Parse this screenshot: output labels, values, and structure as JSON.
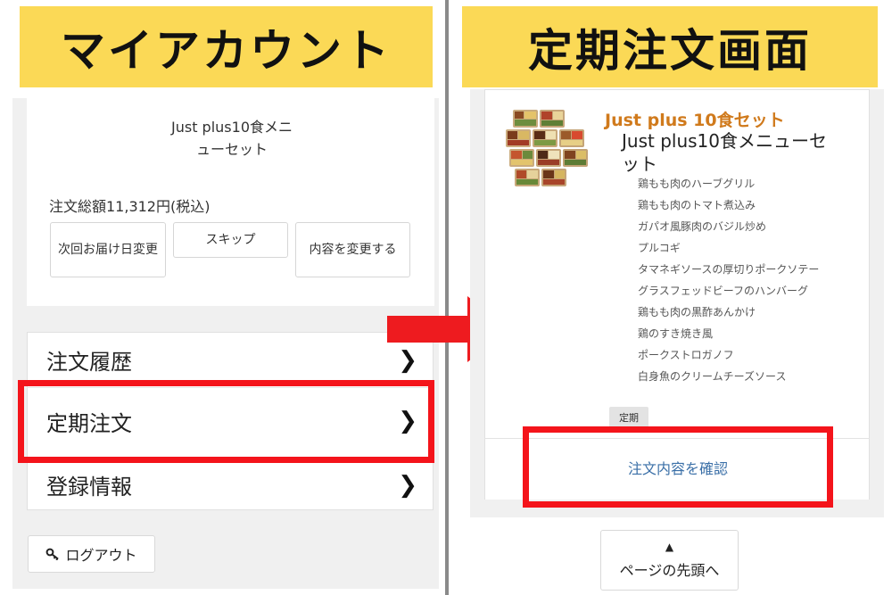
{
  "left": {
    "banner": "マイアカウント",
    "product_name": "Just plus10食メニューセット",
    "order_total": "注文総額11,312円(税込)",
    "buttons": {
      "next_delivery": "次回お届け日変更",
      "skip": "スキップ",
      "change_contents": "内容を変更する"
    },
    "menu": [
      {
        "label": "注文履歴"
      },
      {
        "label": "定期注文"
      },
      {
        "label": "登録情報"
      }
    ],
    "logout": "ログアウト"
  },
  "right": {
    "banner": "定期注文画面",
    "set_title": "Just plus 10食セット",
    "menu_title": "Just plus10食メニューセット",
    "dishes": [
      "鶏もも肉のハーブグリル",
      "鶏もも肉のトマト煮込み",
      "ガパオ風豚肉のバジル炒め",
      "プルコギ",
      "タマネギソースの厚切りポークソテー",
      "グラスフェッドビーフのハンバーグ",
      "鶏もも肉の黒酢あんかけ",
      "鶏のすき焼き風",
      "ポークストロガノフ",
      "白身魚のクリームチーズソース"
    ],
    "tag": "定期",
    "confirm_link": "注文内容を確認",
    "page_top": "ページの先頭へ"
  },
  "icons": {
    "chevron": "chevron-right-icon",
    "key": "key-icon",
    "arrow": "arrow-right-icon",
    "page_top": "triangle-up-icon"
  },
  "colors": {
    "banner_bg": "#fbd956",
    "highlight": "#f4141b",
    "set_title": "#d07a1c",
    "link": "#3a6fa7"
  }
}
